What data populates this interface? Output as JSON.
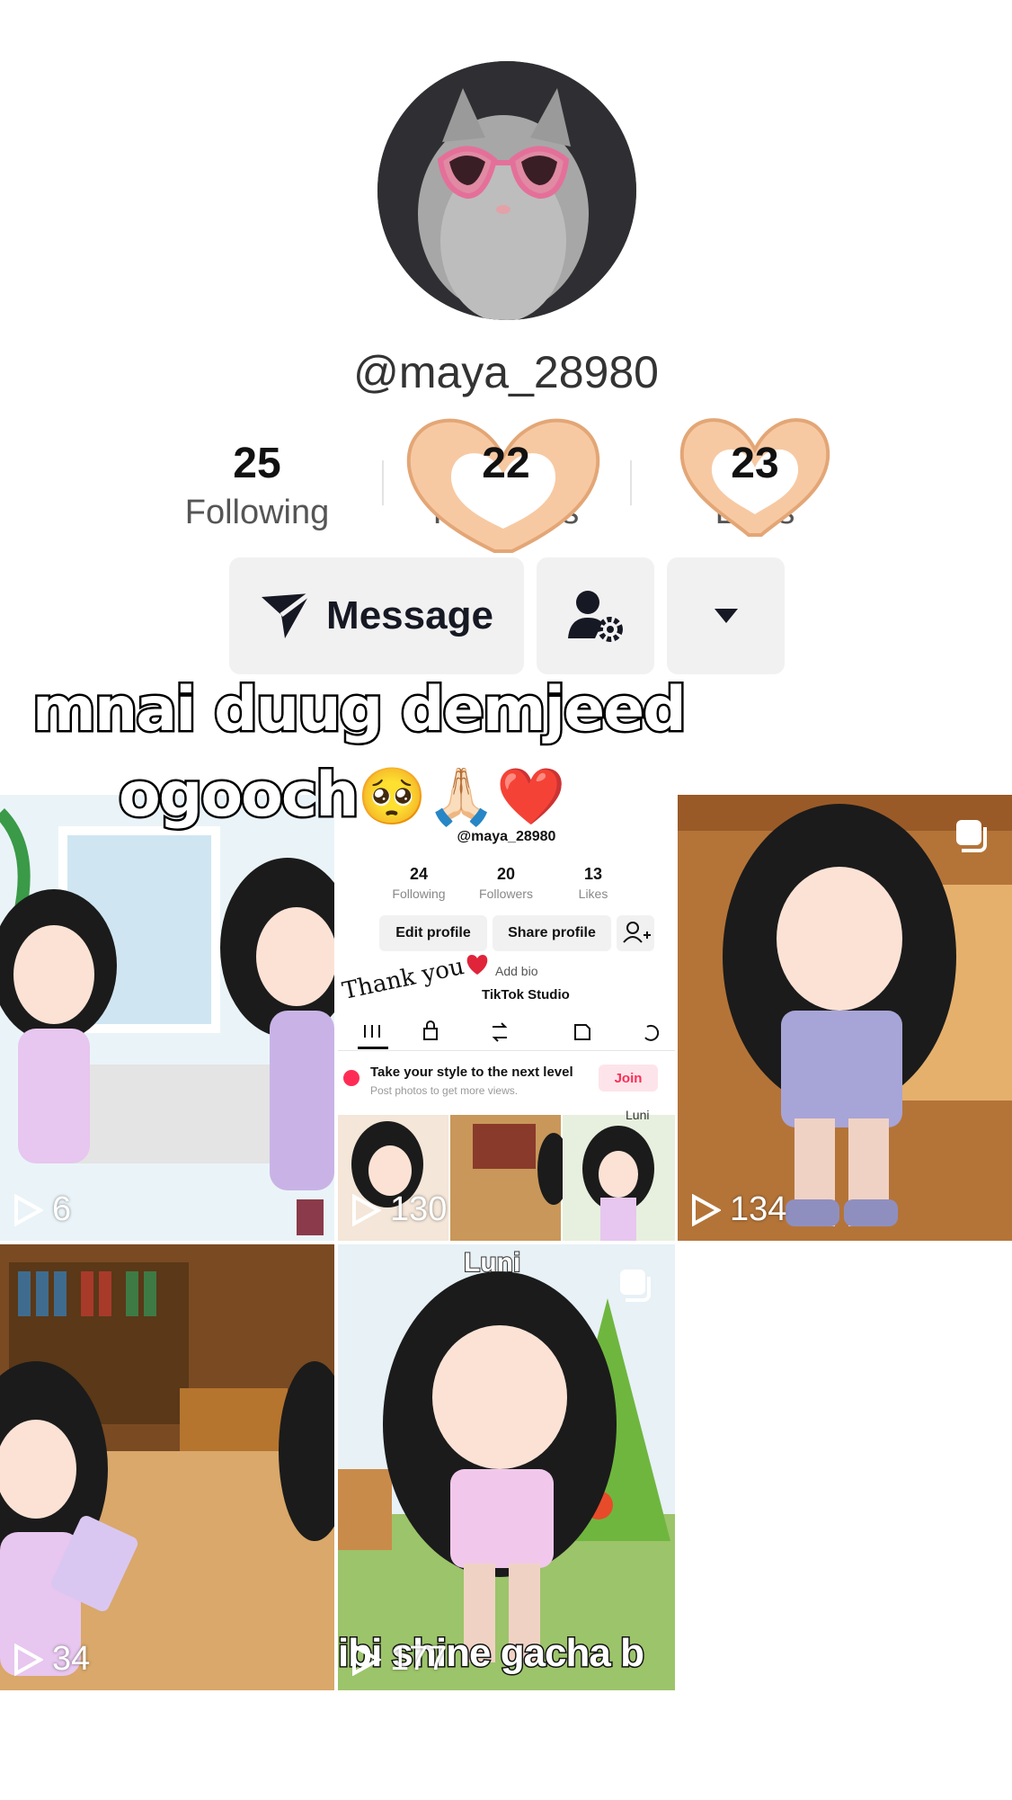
{
  "profile": {
    "username": "@maya_28980",
    "stats": [
      {
        "value": "25",
        "label": "Following"
      },
      {
        "value": "22",
        "label": "Followers"
      },
      {
        "value": "23",
        "label": "Likes"
      }
    ]
  },
  "actions": {
    "message_label": "Message"
  },
  "caption": {
    "line1": "mnai duug demjeed",
    "line2": "ogooch",
    "emojis": "🥺🙏🏻❤️"
  },
  "videos": [
    {
      "views": "6"
    },
    {
      "views": "130"
    },
    {
      "views": "134"
    },
    {
      "views": "34"
    },
    {
      "views": "177"
    }
  ],
  "video2_screenshot": {
    "username": "@maya_28980",
    "stats": [
      {
        "value": "24",
        "label": "Following"
      },
      {
        "value": "20",
        "label": "Followers"
      },
      {
        "value": "13",
        "label": "Likes"
      }
    ],
    "edit_profile": "Edit profile",
    "share_profile": "Share profile",
    "add_bio": "Add bio",
    "studio": "TikTok Studio",
    "thank_you": "Thank you",
    "promo_title": "Take your style to the next level",
    "promo_sub": "Post photos to get more views.",
    "promo_join": "Join",
    "tile_text": "Luni"
  },
  "video5": {
    "top_text": "Luni",
    "bottom_text": "ibi shine gacha b"
  },
  "colors": {
    "button_bg": "#f1f1f2",
    "join_red": "#fe2c55",
    "text_dark": "#161823"
  }
}
